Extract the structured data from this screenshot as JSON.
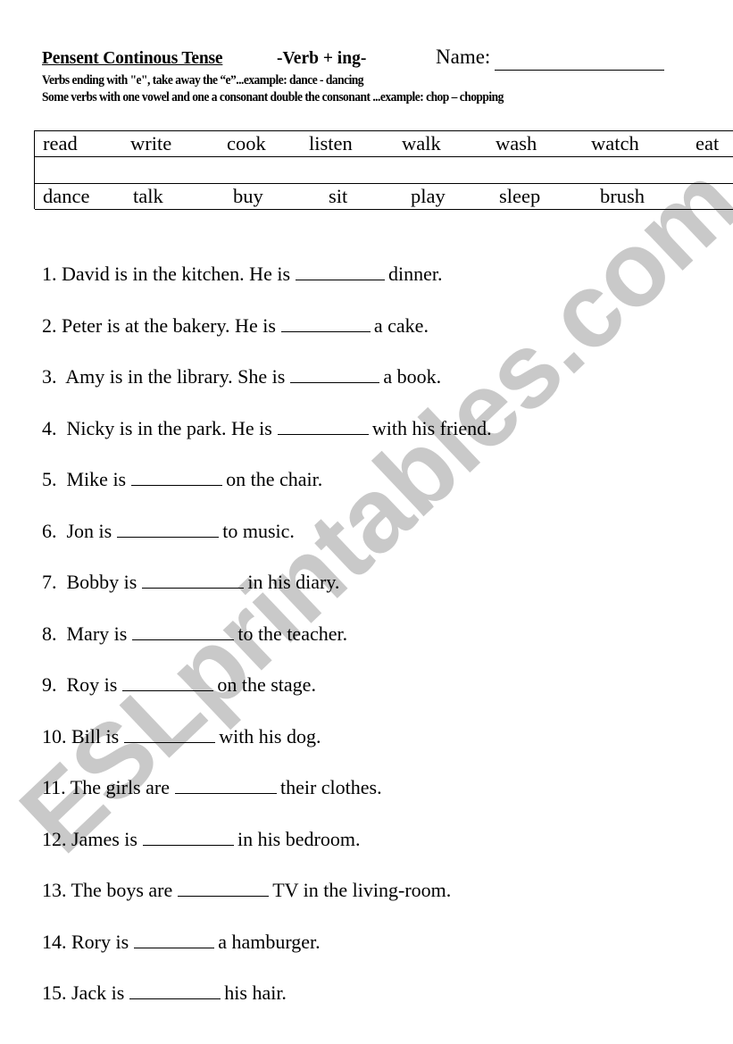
{
  "watermark": "ESLprintables.com",
  "header": {
    "title": "Pensent Continous Tense",
    "subtitle": "-Verb + ing-",
    "name_label": "Name:"
  },
  "rules": [
    "Verbs ending with \"e\", take away the “e”...example: dance - dancing",
    "Some verbs with one vowel and one a consonant double the consonant ...example: chop – chopping"
  ],
  "verb_bank": {
    "row1": [
      "read",
      "write",
      "cook",
      "listen",
      "walk",
      "wash",
      "watch",
      "eat"
    ],
    "row2": [
      "dance",
      "talk",
      "buy",
      "sit",
      "play",
      "sleep",
      "brush"
    ]
  },
  "sentences": [
    {
      "num": "1.",
      "before": "David is in the kitchen. He is",
      "after": "dinner."
    },
    {
      "num": "2.",
      "before": "Peter is at the bakery. He is",
      "after": "a cake."
    },
    {
      "num": "3.",
      "before": " Amy is in the library. She is",
      "after": "a book."
    },
    {
      "num": "4.",
      "before": " Nicky is in the park. He is",
      "after": "with his friend."
    },
    {
      "num": "5.",
      "before": " Mike is",
      "after": "on the chair."
    },
    {
      "num": "6.",
      "before": " Jon is",
      "after": "to music."
    },
    {
      "num": "7.",
      "before": " Bobby is",
      "after": "in his diary."
    },
    {
      "num": "8.",
      "before": " Mary is",
      "after": "to the teacher."
    },
    {
      "num": "9.",
      "before": " Roy is",
      "after": "on the stage."
    },
    {
      "num": "10.",
      "before": "Bill is",
      "after": "with his dog."
    },
    {
      "num": "11.",
      "before": "The girls are",
      "after": "their clothes."
    },
    {
      "num": "12.",
      "before": "James is",
      "after": "in his bedroom."
    },
    {
      "num": "13.",
      "before": "The boys are",
      "after": "TV in the living-room."
    },
    {
      "num": "14.",
      "before": "Rory is",
      "after": "a hamburger."
    },
    {
      "num": "15.",
      "before": "Jack is",
      "after": "his hair."
    }
  ]
}
